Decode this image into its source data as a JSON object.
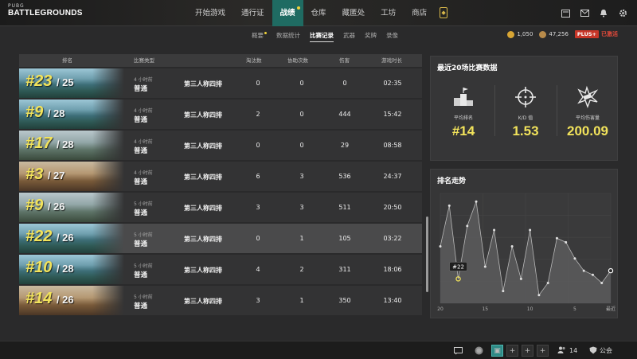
{
  "logo": {
    "line1": "PUBG",
    "line2": "BATTLEGROUNDS"
  },
  "nav": {
    "items": [
      "开始游戏",
      "通行证",
      "战绩",
      "仓库",
      "藏匿处",
      "工坊",
      "商店"
    ],
    "active_index": 2
  },
  "subnav": {
    "items": [
      "概要",
      "数据统计",
      "比赛记录",
      "武器",
      "奖牌",
      "录像"
    ],
    "active_index": 2
  },
  "currency": {
    "gcoin": "1,050",
    "bp": "47,256",
    "plus_badge": "PLUS+",
    "plus_status": "已激活"
  },
  "table": {
    "headers": {
      "rank": "排名",
      "type": "比赛类型",
      "kills": "淘汰数",
      "assists": "协助次数",
      "damage": "伤害",
      "duration": "游戏时长"
    },
    "rows": [
      {
        "rank": "#23",
        "total": "/ 25",
        "time": "4 小时前",
        "type": "普通",
        "mode": "第三人称四排",
        "kills": "0",
        "assists": "0",
        "damage": "0",
        "duration": "02:35",
        "map": "sea"
      },
      {
        "rank": "#9",
        "total": "/ 28",
        "time": "4 小时前",
        "type": "普通",
        "mode": "第三人称四排",
        "kills": "2",
        "assists": "0",
        "damage": "444",
        "duration": "15:42",
        "map": "sea"
      },
      {
        "rank": "#17",
        "total": "/ 28",
        "time": "4 小时前",
        "type": "普通",
        "mode": "第三人称四排",
        "kills": "0",
        "assists": "0",
        "damage": "29",
        "duration": "08:58",
        "map": "mountain"
      },
      {
        "rank": "#3",
        "total": "/ 27",
        "time": "4 小时前",
        "type": "普通",
        "mode": "第三人称四排",
        "kills": "6",
        "assists": "3",
        "damage": "536",
        "duration": "24:37",
        "map": "desert"
      },
      {
        "rank": "#9",
        "total": "/ 26",
        "time": "5 小时前",
        "type": "普通",
        "mode": "第三人称四排",
        "kills": "3",
        "assists": "3",
        "damage": "511",
        "duration": "20:50",
        "map": "mountain"
      },
      {
        "rank": "#22",
        "total": "/ 26",
        "time": "5 小时前",
        "type": "普通",
        "mode": "第三人称四排",
        "kills": "0",
        "assists": "1",
        "damage": "105",
        "duration": "03:22",
        "map": "sea",
        "highlight": true
      },
      {
        "rank": "#10",
        "total": "/ 28",
        "time": "5 小时前",
        "type": "普通",
        "mode": "第三人称四排",
        "kills": "4",
        "assists": "2",
        "damage": "311",
        "duration": "18:06",
        "map": "sea"
      },
      {
        "rank": "#14",
        "total": "/ 26",
        "time": "5 小时前",
        "type": "普通",
        "mode": "第三人称四排",
        "kills": "3",
        "assists": "1",
        "damage": "350",
        "duration": "13:40",
        "map": "desert"
      }
    ]
  },
  "recent": {
    "title": "最近20场比赛数据",
    "stats": [
      {
        "icon": "podium-icon",
        "label": "平均排名",
        "value": "#14"
      },
      {
        "icon": "crosshair-icon",
        "label": "K/D 值",
        "value": "1.53"
      },
      {
        "icon": "explosion-icon",
        "label": "平均伤害量",
        "value": "200.09"
      }
    ]
  },
  "trend": {
    "title": "排名走势",
    "x_tick_labels": [
      "20",
      "15",
      "10",
      "5",
      "最近"
    ],
    "marker_label": "#22"
  },
  "chart_data": {
    "type": "area",
    "title": "排名走势",
    "x": [
      20,
      19,
      18,
      17,
      16,
      15,
      14,
      13,
      12,
      11,
      10,
      9,
      8,
      7,
      6,
      5,
      4,
      3,
      2,
      1
    ],
    "values": [
      14,
      4,
      22,
      9,
      3,
      19,
      10,
      25,
      14,
      22,
      10,
      26,
      23,
      12,
      13,
      17,
      20,
      21,
      23,
      20
    ],
    "marker": {
      "index": 2,
      "label": "#22"
    },
    "x_tick_labels": [
      "20",
      "15",
      "10",
      "5",
      "最近"
    ],
    "y_inverted": true,
    "ylim": [
      1,
      28
    ],
    "grid": true
  },
  "bottombar": {
    "friends_count": "14",
    "clan_label": "公会"
  },
  "colors": {
    "accent_nav": "#1f6b62",
    "rank_yellow": "#f2e35b",
    "plus_red": "#c73628"
  }
}
